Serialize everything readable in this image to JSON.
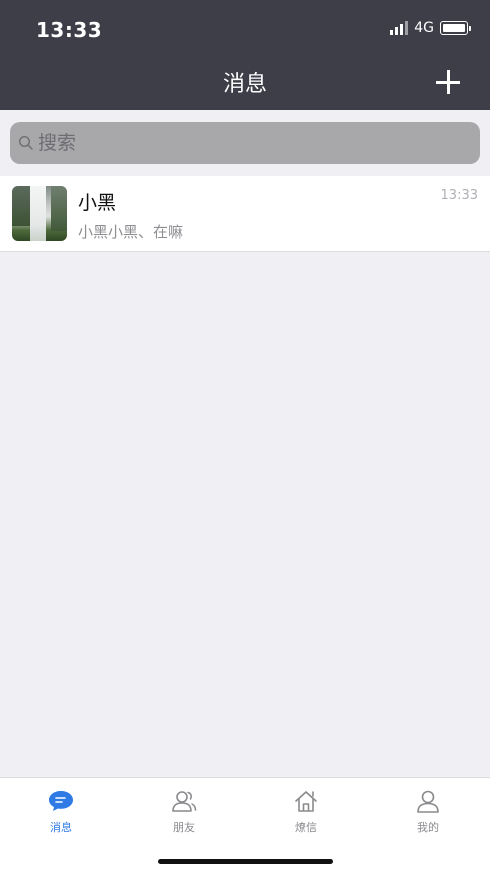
{
  "status_bar": {
    "time": "13:33",
    "network": "4G"
  },
  "nav": {
    "title": "消息"
  },
  "search": {
    "placeholder": "搜索"
  },
  "chats": [
    {
      "name": "小黑",
      "preview": "小黑小黑、在嘛",
      "time": "13:33"
    }
  ],
  "tabs": [
    {
      "label": "消息",
      "icon": "chat-bubble-icon",
      "active": true
    },
    {
      "label": "朋友",
      "icon": "friends-icon",
      "active": false
    },
    {
      "label": "燎信",
      "icon": "home-icon",
      "active": false
    },
    {
      "label": "我的",
      "icon": "profile-icon",
      "active": false
    }
  ],
  "colors": {
    "header_bg": "#3d3e48",
    "accent": "#2f7ae5",
    "background": "#efeff4"
  }
}
